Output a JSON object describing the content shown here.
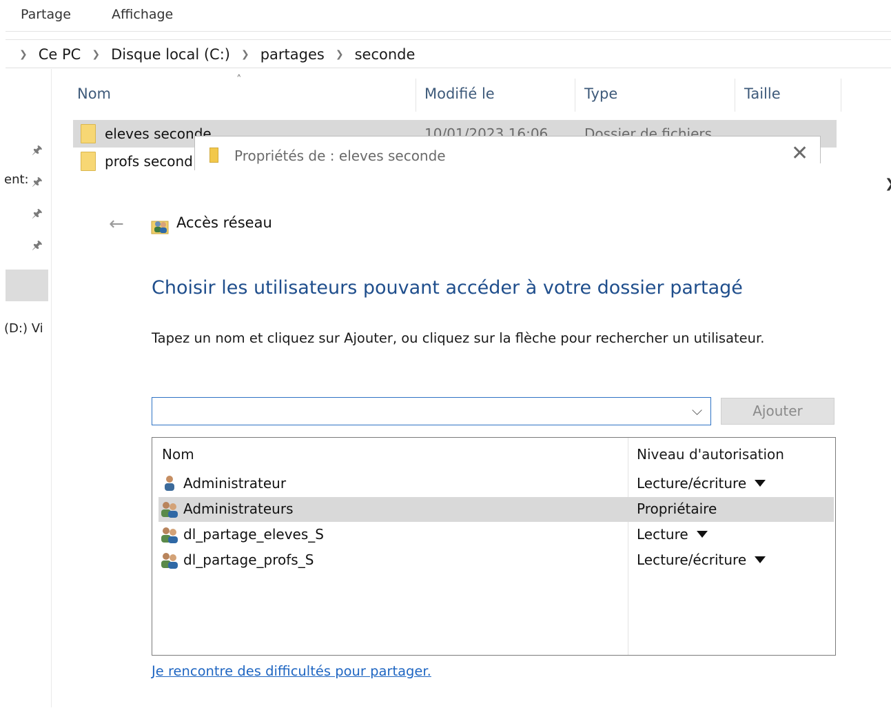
{
  "ribbon": {
    "tabs": [
      "Partage",
      "Affichage"
    ]
  },
  "address": {
    "crumbs": [
      "Ce PC",
      "Disque local (C:)",
      "partages",
      "seconde"
    ]
  },
  "nav": {
    "items_partial": [
      "ent:",
      "(D:) Vi"
    ]
  },
  "filelist": {
    "columns": [
      "Nom",
      "Modifié le",
      "Type",
      "Taille"
    ],
    "rows": [
      {
        "name": "eleves seconde",
        "modified": "10/01/2023 16:06",
        "type": "Dossier de fichiers"
      },
      {
        "name": "profs second",
        "modified": "",
        "type": ""
      }
    ]
  },
  "dialog": {
    "title": "Propriétés de : eleves seconde",
    "wizard_title": "Accès réseau",
    "heading": "Choisir les utilisateurs pouvant accéder à votre dossier partagé",
    "instruction": "Tapez un nom et cliquez sur Ajouter, ou cliquez sur la flèche pour rechercher un utilisateur.",
    "input_value": "",
    "add_label": "Ajouter",
    "table": {
      "headers": [
        "Nom",
        "Niveau d'autorisation"
      ],
      "rows": [
        {
          "name": "Administrateur",
          "permission": "Lecture/écriture",
          "dropdown": true,
          "icon": "user-icon"
        },
        {
          "name": "Administrateurs",
          "permission": "Propriétaire",
          "dropdown": false,
          "icon": "group-icon"
        },
        {
          "name": "dl_partage_eleves_S",
          "permission": "Lecture",
          "dropdown": true,
          "icon": "group-icon"
        },
        {
          "name": "dl_partage_profs_S",
          "permission": "Lecture/écriture",
          "dropdown": true,
          "icon": "group-icon"
        }
      ]
    },
    "help_link": "Je rencontre des difficultés pour partager."
  },
  "colors": {
    "accent": "#1f4e8c",
    "link": "#1f66c2",
    "selection": "#d9d9d9"
  }
}
